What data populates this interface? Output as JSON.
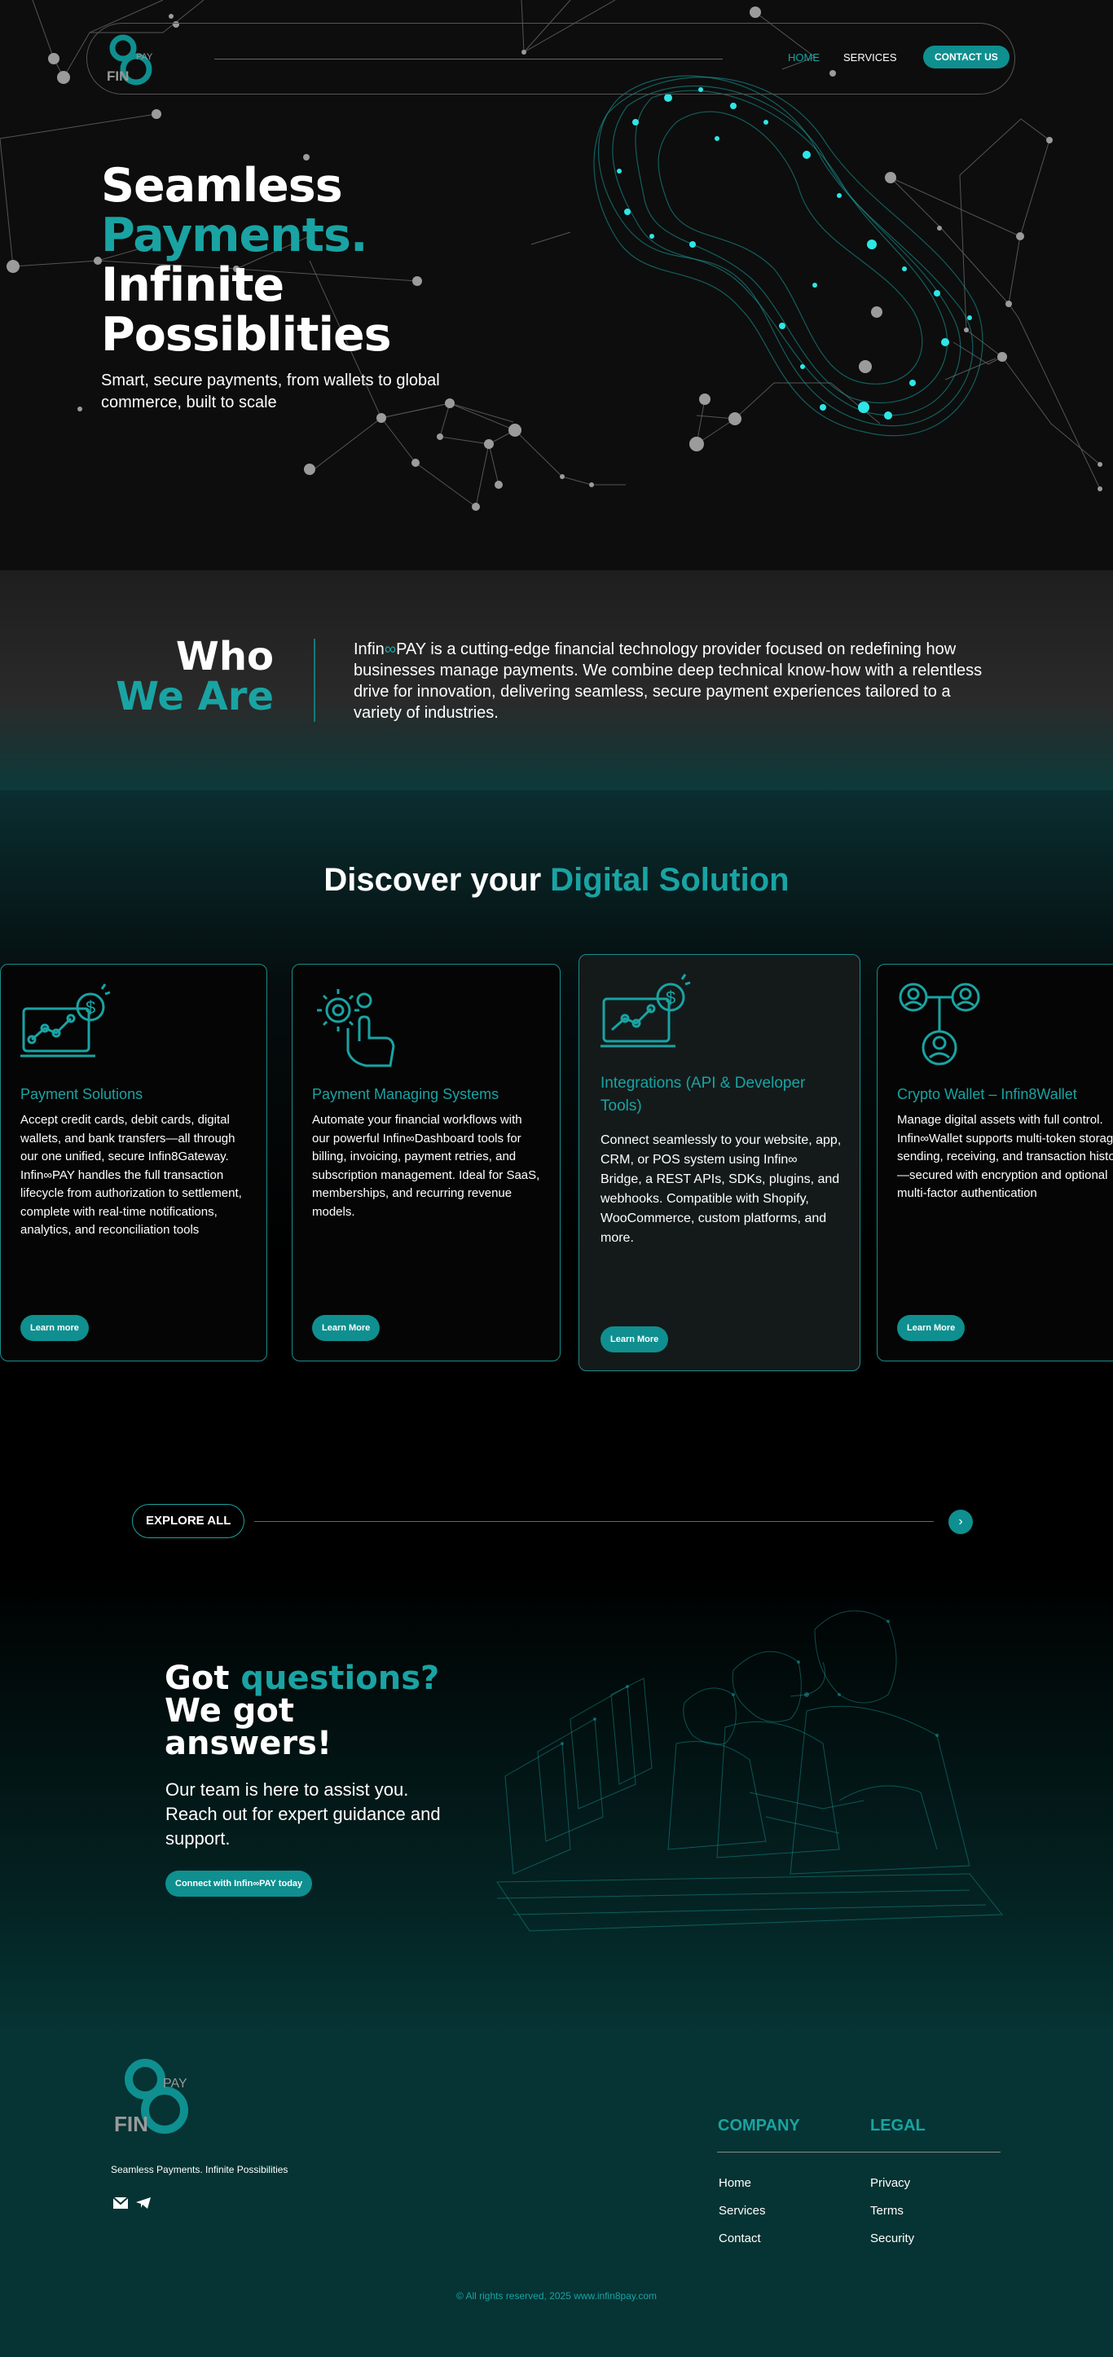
{
  "nav": {
    "brand_fin": "FIN",
    "brand_pay": "PAY",
    "home": "HOME",
    "services": "SERVICES",
    "contact": "CONTACT US"
  },
  "hero": {
    "title_line1": "Seamless",
    "title_line2": "Payments.",
    "title_line3": "Infinite",
    "title_line4": "Possiblities",
    "subtitle": "Smart, secure payments, from wallets to global commerce, built to scale"
  },
  "who": {
    "title_line1": "Who",
    "title_line2": "We Are",
    "text_prefix": "Infin",
    "text_body": "PAY is a cutting-edge financial technology provider focused on redefining how businesses manage payments. We combine deep technical know-how with a relentless drive for innovation, delivering seamless, secure payment experiences tailored to a variety of industries."
  },
  "services": {
    "heading_a": "Discover your",
    "heading_b": "Digital Solution",
    "cards": [
      {
        "icon": "laptop-chart-icon",
        "title": "Payment Solutions",
        "desc": "Accept credit cards, debit cards, digital wallets, and bank transfers—all through our one unified, secure Infin8Gateway. Infin∞PAY handles the full transaction lifecycle from authorization to settlement, complete with real-time notifications, analytics, and reconciliation tools",
        "button": "Learn more"
      },
      {
        "icon": "gear-hand-icon",
        "title": "Payment Managing Systems",
        "desc": "Automate your financial workflows with our powerful Infin∞Dashboard tools for billing, invoicing, payment retries, and subscription management. Ideal for SaaS, memberships, and recurring revenue models.",
        "button": "Learn More"
      },
      {
        "icon": "laptop-dollar-icon",
        "title": "Integrations (API & Developer Tools)",
        "desc": "Connect seamlessly to your website, app, CRM, or POS system using Infin∞ Bridge, a REST APIs, SDKs, plugins, and webhooks. Compatible with Shopify, WooCommerce, custom platforms, and more.",
        "button": "Learn More"
      },
      {
        "icon": "users-network-icon",
        "title": "Crypto Wallet – Infin8Wallet",
        "desc": "Manage digital assets with full control. Infin∞Wallet supports multi-token storage, sending, receiving, and transaction history—secured with encryption and optional multi-factor authentication",
        "button": "Learn More"
      }
    ],
    "explore": "EXPLORE ALL"
  },
  "questions": {
    "title_a": "Got",
    "title_b": "questions?",
    "title_c": "We got",
    "title_d": "answers!",
    "subtitle": "Our team is here to assist you. Reach out for expert guidance and support.",
    "button": "Connect with Infin∞PAY today"
  },
  "footer": {
    "tagline": "Seamless Payments. Infinite Possibilities",
    "company_heading": "COMPANY",
    "legal_heading": "LEGAL",
    "company_links": [
      "Home",
      "Services",
      "Contact"
    ],
    "legal_links": [
      "Privacy",
      "Terms",
      "Security"
    ],
    "copyright": "© All rights reserved, 2025 www.infin8pay.com"
  },
  "colors": {
    "accent": "#1aa3a3",
    "button": "#0f8f8f",
    "background": "#0d0d0d",
    "footer": "#063333"
  }
}
